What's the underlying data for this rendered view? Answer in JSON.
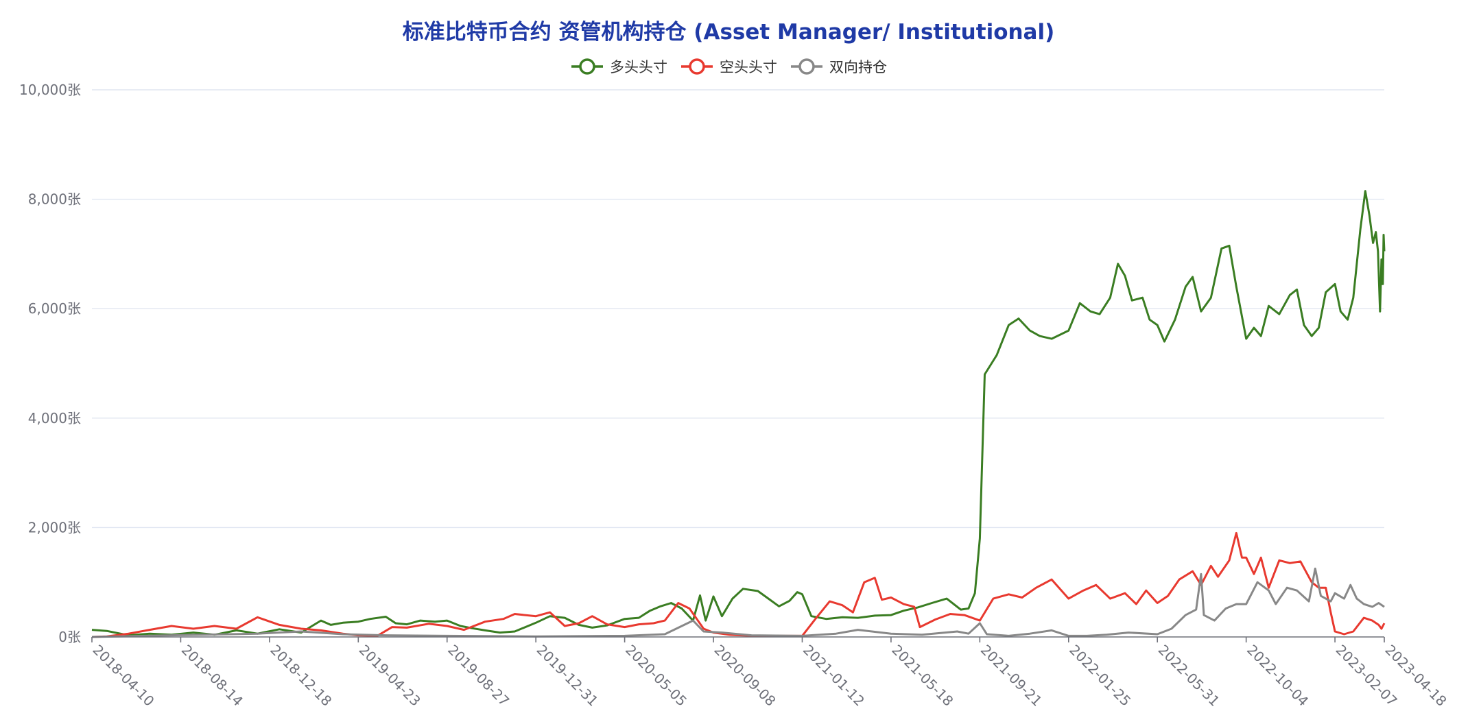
{
  "chart_data": {
    "type": "line",
    "title": "标准比特币合约 资管机构持仓 (Asset Manager/ Institutional)",
    "ylim": [
      0,
      10000
    ],
    "y_ticks": [
      "0张",
      "2,000张",
      "4,000张",
      "6,000张",
      "8,000张",
      "10,000张"
    ],
    "y_tick_values": [
      0,
      2000,
      4000,
      6000,
      8000,
      10000
    ],
    "x_tick_labels": [
      "2018-04-10",
      "2018-08-14",
      "2018-12-18",
      "2019-04-23",
      "2019-08-27",
      "2019-12-31",
      "2020-05-05",
      "2020-09-08",
      "2021-01-12",
      "2021-05-18",
      "2021-09-21",
      "2022-01-25",
      "2022-05-31",
      "2022-10-04",
      "2023-02-07",
      "2023-04-18"
    ],
    "x_range": [
      "2018-04-10",
      "2023-04-18"
    ],
    "grid": true,
    "legend_position": "top-center",
    "series": [
      {
        "name": "多头头寸",
        "color": "#3a7d22",
        "points": [
          [
            "2018-04-10",
            130
          ],
          [
            "2018-05-01",
            110
          ],
          [
            "2018-06-01",
            30
          ],
          [
            "2018-07-01",
            60
          ],
          [
            "2018-08-01",
            40
          ],
          [
            "2018-09-01",
            80
          ],
          [
            "2018-10-01",
            40
          ],
          [
            "2018-11-01",
            120
          ],
          [
            "2018-12-01",
            60
          ],
          [
            "2019-01-01",
            140
          ],
          [
            "2019-02-01",
            80
          ],
          [
            "2019-03-01",
            300
          ],
          [
            "2019-03-15",
            220
          ],
          [
            "2019-04-01",
            260
          ],
          [
            "2019-04-23",
            280
          ],
          [
            "2019-05-10",
            330
          ],
          [
            "2019-06-01",
            370
          ],
          [
            "2019-06-15",
            250
          ],
          [
            "2019-07-01",
            230
          ],
          [
            "2019-07-20",
            300
          ],
          [
            "2019-08-10",
            280
          ],
          [
            "2019-08-27",
            300
          ],
          [
            "2019-09-15",
            200
          ],
          [
            "2019-10-01",
            160
          ],
          [
            "2019-10-20",
            120
          ],
          [
            "2019-11-10",
            80
          ],
          [
            "2019-12-01",
            100
          ],
          [
            "2019-12-31",
            260
          ],
          [
            "2020-01-20",
            380
          ],
          [
            "2020-02-10",
            350
          ],
          [
            "2020-03-01",
            220
          ],
          [
            "2020-03-20",
            170
          ],
          [
            "2020-04-10",
            210
          ],
          [
            "2020-05-05",
            330
          ],
          [
            "2020-05-25",
            350
          ],
          [
            "2020-06-10",
            480
          ],
          [
            "2020-06-25",
            560
          ],
          [
            "2020-07-10",
            620
          ],
          [
            "2020-07-25",
            520
          ],
          [
            "2020-08-10",
            300
          ],
          [
            "2020-08-20",
            760
          ],
          [
            "2020-08-28",
            300
          ],
          [
            "2020-09-08",
            740
          ],
          [
            "2020-09-20",
            380
          ],
          [
            "2020-10-05",
            700
          ],
          [
            "2020-10-20",
            880
          ],
          [
            "2020-11-10",
            840
          ],
          [
            "2020-11-25",
            700
          ],
          [
            "2020-12-10",
            560
          ],
          [
            "2020-12-25",
            660
          ],
          [
            "2021-01-05",
            820
          ],
          [
            "2021-01-12",
            780
          ],
          [
            "2021-01-25",
            380
          ],
          [
            "2021-02-15",
            330
          ],
          [
            "2021-03-10",
            360
          ],
          [
            "2021-04-01",
            350
          ],
          [
            "2021-04-25",
            390
          ],
          [
            "2021-05-18",
            400
          ],
          [
            "2021-06-05",
            480
          ],
          [
            "2021-06-25",
            540
          ],
          [
            "2021-07-15",
            620
          ],
          [
            "2021-08-05",
            700
          ],
          [
            "2021-08-25",
            500
          ],
          [
            "2021-09-05",
            520
          ],
          [
            "2021-09-14",
            800
          ],
          [
            "2021-09-21",
            1800
          ],
          [
            "2021-09-28",
            4800
          ],
          [
            "2021-10-15",
            5150
          ],
          [
            "2021-11-01",
            5700
          ],
          [
            "2021-11-15",
            5820
          ],
          [
            "2021-12-01",
            5600
          ],
          [
            "2021-12-15",
            5500
          ],
          [
            "2022-01-01",
            5450
          ],
          [
            "2022-01-25",
            5600
          ],
          [
            "2022-02-10",
            6100
          ],
          [
            "2022-02-25",
            5950
          ],
          [
            "2022-03-10",
            5900
          ],
          [
            "2022-03-25",
            6200
          ],
          [
            "2022-04-05",
            6820
          ],
          [
            "2022-04-15",
            6600
          ],
          [
            "2022-04-25",
            6150
          ],
          [
            "2022-05-10",
            6200
          ],
          [
            "2022-05-20",
            5800
          ],
          [
            "2022-05-31",
            5700
          ],
          [
            "2022-06-10",
            5400
          ],
          [
            "2022-06-25",
            5800
          ],
          [
            "2022-07-10",
            6400
          ],
          [
            "2022-07-20",
            6580
          ],
          [
            "2022-08-01",
            5950
          ],
          [
            "2022-08-15",
            6200
          ],
          [
            "2022-08-30",
            7100
          ],
          [
            "2022-09-10",
            7150
          ],
          [
            "2022-09-20",
            6400
          ],
          [
            "2022-10-04",
            5450
          ],
          [
            "2022-10-15",
            5650
          ],
          [
            "2022-10-25",
            5500
          ],
          [
            "2022-11-05",
            6050
          ],
          [
            "2022-11-20",
            5900
          ],
          [
            "2022-12-05",
            6250
          ],
          [
            "2022-12-15",
            6350
          ],
          [
            "2022-12-25",
            5700
          ],
          [
            "2023-01-05",
            5500
          ],
          [
            "2023-01-15",
            5650
          ],
          [
            "2023-01-25",
            6300
          ],
          [
            "2023-02-07",
            6450
          ],
          [
            "2023-02-15",
            5950
          ],
          [
            "2023-02-25",
            5800
          ],
          [
            "2023-03-05",
            6200
          ],
          [
            "2023-03-15",
            7450
          ],
          [
            "2023-03-22",
            8150
          ],
          [
            "2023-03-28",
            7700
          ],
          [
            "2023-04-02",
            7200
          ],
          [
            "2023-04-06",
            7400
          ],
          [
            "2023-04-09",
            7050
          ],
          [
            "2023-04-12",
            5950
          ],
          [
            "2023-04-14",
            6900
          ],
          [
            "2023-04-15",
            6450
          ],
          [
            "2023-04-16",
            6450
          ],
          [
            "2023-04-17",
            7350
          ],
          [
            "2023-04-18",
            7050
          ]
        ]
      },
      {
        "name": "空头头寸",
        "color": "#e8392f",
        "points": [
          [
            "2018-04-10",
            0
          ],
          [
            "2018-05-01",
            10
          ],
          [
            "2018-06-01",
            60
          ],
          [
            "2018-07-01",
            130
          ],
          [
            "2018-08-01",
            200
          ],
          [
            "2018-09-01",
            150
          ],
          [
            "2018-10-01",
            200
          ],
          [
            "2018-11-01",
            150
          ],
          [
            "2018-12-01",
            360
          ],
          [
            "2019-01-01",
            220
          ],
          [
            "2019-02-01",
            150
          ],
          [
            "2019-03-01",
            120
          ],
          [
            "2019-04-01",
            60
          ],
          [
            "2019-04-23",
            30
          ],
          [
            "2019-05-20",
            20
          ],
          [
            "2019-06-10",
            180
          ],
          [
            "2019-07-01",
            170
          ],
          [
            "2019-08-01",
            240
          ],
          [
            "2019-08-27",
            200
          ],
          [
            "2019-09-20",
            130
          ],
          [
            "2019-10-20",
            280
          ],
          [
            "2019-11-15",
            330
          ],
          [
            "2019-12-01",
            420
          ],
          [
            "2019-12-31",
            380
          ],
          [
            "2020-01-20",
            450
          ],
          [
            "2020-02-10",
            200
          ],
          [
            "2020-03-01",
            250
          ],
          [
            "2020-03-20",
            380
          ],
          [
            "2020-04-10",
            230
          ],
          [
            "2020-05-05",
            180
          ],
          [
            "2020-05-25",
            230
          ],
          [
            "2020-06-15",
            250
          ],
          [
            "2020-07-01",
            300
          ],
          [
            "2020-07-20",
            620
          ],
          [
            "2020-08-05",
            520
          ],
          [
            "2020-08-25",
            150
          ],
          [
            "2020-09-08",
            80
          ],
          [
            "2020-10-01",
            40
          ],
          [
            "2020-11-01",
            20
          ],
          [
            "2020-12-01",
            20
          ],
          [
            "2021-01-12",
            20
          ],
          [
            "2021-02-01",
            350
          ],
          [
            "2021-02-20",
            650
          ],
          [
            "2021-03-10",
            580
          ],
          [
            "2021-03-25",
            450
          ],
          [
            "2021-04-10",
            1000
          ],
          [
            "2021-04-25",
            1080
          ],
          [
            "2021-05-05",
            680
          ],
          [
            "2021-05-18",
            720
          ],
          [
            "2021-06-05",
            600
          ],
          [
            "2021-06-20",
            550
          ],
          [
            "2021-06-28",
            180
          ],
          [
            "2021-07-20",
            320
          ],
          [
            "2021-08-10",
            420
          ],
          [
            "2021-08-30",
            400
          ],
          [
            "2021-09-21",
            300
          ],
          [
            "2021-10-10",
            700
          ],
          [
            "2021-11-01",
            780
          ],
          [
            "2021-11-20",
            720
          ],
          [
            "2021-12-10",
            900
          ],
          [
            "2022-01-01",
            1050
          ],
          [
            "2022-01-25",
            700
          ],
          [
            "2022-02-15",
            850
          ],
          [
            "2022-03-05",
            950
          ],
          [
            "2022-03-25",
            700
          ],
          [
            "2022-04-15",
            800
          ],
          [
            "2022-05-01",
            600
          ],
          [
            "2022-05-15",
            850
          ],
          [
            "2022-05-31",
            620
          ],
          [
            "2022-06-15",
            750
          ],
          [
            "2022-07-01",
            1050
          ],
          [
            "2022-07-20",
            1200
          ],
          [
            "2022-08-01",
            950
          ],
          [
            "2022-08-15",
            1300
          ],
          [
            "2022-08-25",
            1100
          ],
          [
            "2022-09-10",
            1400
          ],
          [
            "2022-09-20",
            1900
          ],
          [
            "2022-09-28",
            1450
          ],
          [
            "2022-10-04",
            1450
          ],
          [
            "2022-10-15",
            1150
          ],
          [
            "2022-10-25",
            1450
          ],
          [
            "2022-11-05",
            900
          ],
          [
            "2022-11-20",
            1400
          ],
          [
            "2022-12-05",
            1350
          ],
          [
            "2022-12-20",
            1380
          ],
          [
            "2023-01-05",
            1000
          ],
          [
            "2023-01-15",
            900
          ],
          [
            "2023-01-25",
            900
          ],
          [
            "2023-02-01",
            450
          ],
          [
            "2023-02-07",
            100
          ],
          [
            "2023-02-20",
            50
          ],
          [
            "2023-03-05",
            100
          ],
          [
            "2023-03-20",
            350
          ],
          [
            "2023-04-01",
            300
          ],
          [
            "2023-04-10",
            220
          ],
          [
            "2023-04-14",
            150
          ],
          [
            "2023-04-18",
            250
          ]
        ]
      },
      {
        "name": "双向持仓",
        "color": "#888888",
        "points": [
          [
            "2018-04-10",
            0
          ],
          [
            "2018-08-01",
            30
          ],
          [
            "2018-12-01",
            60
          ],
          [
            "2019-02-01",
            100
          ],
          [
            "2019-04-01",
            50
          ],
          [
            "2019-06-01",
            30
          ],
          [
            "2019-08-27",
            20
          ],
          [
            "2019-12-31",
            10
          ],
          [
            "2020-05-05",
            20
          ],
          [
            "2020-07-01",
            50
          ],
          [
            "2020-08-10",
            300
          ],
          [
            "2020-08-25",
            100
          ],
          [
            "2020-09-20",
            80
          ],
          [
            "2020-11-01",
            30
          ],
          [
            "2021-01-12",
            20
          ],
          [
            "2021-03-01",
            60
          ],
          [
            "2021-04-01",
            130
          ],
          [
            "2021-05-18",
            60
          ],
          [
            "2021-07-01",
            40
          ],
          [
            "2021-08-20",
            100
          ],
          [
            "2021-09-05",
            60
          ],
          [
            "2021-09-21",
            250
          ],
          [
            "2021-10-01",
            50
          ],
          [
            "2021-11-01",
            20
          ],
          [
            "2021-12-01",
            60
          ],
          [
            "2022-01-01",
            120
          ],
          [
            "2022-01-25",
            20
          ],
          [
            "2022-02-20",
            20
          ],
          [
            "2022-03-20",
            40
          ],
          [
            "2022-04-20",
            80
          ],
          [
            "2022-05-31",
            50
          ],
          [
            "2022-06-20",
            150
          ],
          [
            "2022-07-10",
            400
          ],
          [
            "2022-07-25",
            500
          ],
          [
            "2022-08-01",
            1150
          ],
          [
            "2022-08-05",
            400
          ],
          [
            "2022-08-20",
            300
          ],
          [
            "2022-09-05",
            520
          ],
          [
            "2022-09-20",
            600
          ],
          [
            "2022-10-04",
            600
          ],
          [
            "2022-10-20",
            1000
          ],
          [
            "2022-11-05",
            850
          ],
          [
            "2022-11-15",
            600
          ],
          [
            "2022-12-01",
            900
          ],
          [
            "2022-12-15",
            850
          ],
          [
            "2023-01-01",
            650
          ],
          [
            "2023-01-10",
            1250
          ],
          [
            "2023-01-18",
            750
          ],
          [
            "2023-02-01",
            650
          ],
          [
            "2023-02-07",
            800
          ],
          [
            "2023-02-20",
            700
          ],
          [
            "2023-03-01",
            950
          ],
          [
            "2023-03-10",
            700
          ],
          [
            "2023-03-20",
            600
          ],
          [
            "2023-04-01",
            550
          ],
          [
            "2023-04-10",
            620
          ],
          [
            "2023-04-18",
            550
          ]
        ]
      }
    ]
  }
}
